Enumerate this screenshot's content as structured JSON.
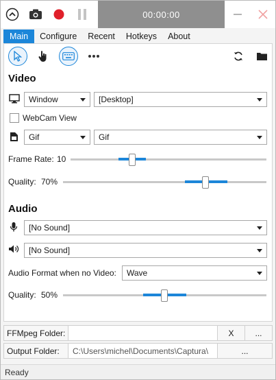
{
  "titlebar": {
    "timer": "00:00:00",
    "icons": [
      "collapse-icon",
      "screenshot-icon",
      "record-icon",
      "pause-icon",
      "minimize-icon",
      "close-icon"
    ],
    "record_color": "#e0202a"
  },
  "tabs": [
    "Main",
    "Configure",
    "Recent",
    "Hotkeys",
    "About"
  ],
  "active_tab": "Main",
  "toolbar": {
    "left": [
      "cursor-icon",
      "click-hand-icon",
      "keyboard-icon",
      "more-icon"
    ],
    "right": [
      "refresh-icon",
      "folder-icon"
    ]
  },
  "video": {
    "title": "Video",
    "source_type": "Window",
    "source": "[Desktop]",
    "webcam_label": "WebCam View",
    "webcam_checked": false,
    "format": "Gif",
    "codec": "Gif",
    "frame_rate_label": "Frame Rate:",
    "frame_rate": "10",
    "frame_rate_fraction": 0.32,
    "quality_label": "Quality:",
    "quality": "70%",
    "quality_fraction": 0.7
  },
  "audio": {
    "title": "Audio",
    "mic": "[No Sound]",
    "speaker": "[No Sound]",
    "format_label": "Audio Format when no Video:",
    "format": "Wave",
    "quality_label": "Quality:",
    "quality": "50%",
    "quality_fraction": 0.5
  },
  "folders": {
    "ffmpeg_label": "FFMpeg Folder:",
    "ffmpeg_path": "",
    "ffmpeg_clear": "X",
    "ffmpeg_browse": "...",
    "output_label": "Output Folder:",
    "output_path": "C:\\Users\\michel\\Documents\\Captura\\",
    "output_browse": "..."
  },
  "status": "Ready",
  "accent": "#1c86d9"
}
